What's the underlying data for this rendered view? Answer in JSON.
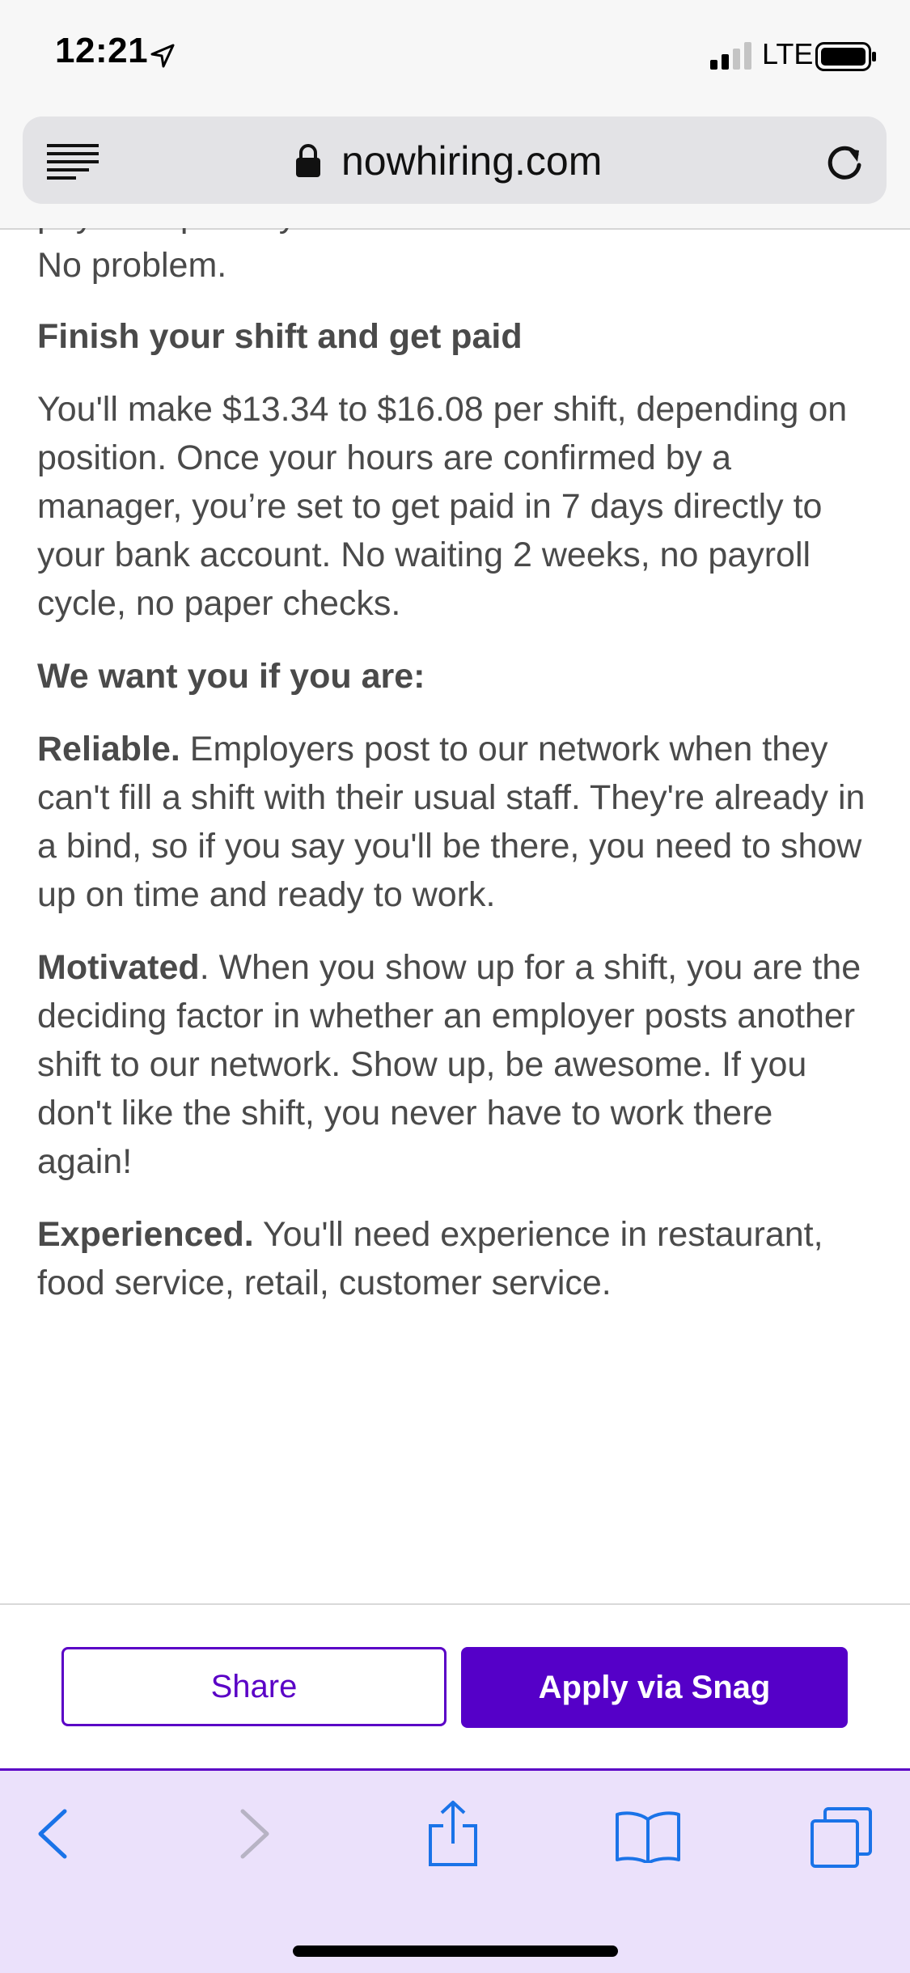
{
  "status_bar": {
    "time": "12:21",
    "network": "LTE",
    "icons": [
      "location-arrow-icon",
      "cellular-signal-icon",
      "battery-icon"
    ]
  },
  "address_bar": {
    "url": "nowhiring.com",
    "icons": [
      "reader-view-icon",
      "lock-icon",
      "reload-icon"
    ]
  },
  "article": {
    "clipped_line": "payment per day...",
    "no_problem": "No problem.",
    "finish_heading": "Finish your shift and get paid",
    "pay_paragraph": "You'll make $13.34 to $16.08 per shift, depending on position. Once your hours are confirmed by a manager, you’re set to get paid in 7 days directly to your bank account. No waiting 2 weeks, no payroll cycle, no paper checks.",
    "want_heading": "We want you if you are:",
    "reliable": {
      "lead": "Reliable.",
      "text": " Employers post to our network when they can't fill a shift with their usual staff. They're already in a bind, so if you say you'll be there, you need to show up on time and ready to work."
    },
    "motivated": {
      "lead": "Motivated",
      "text": ". When you show up for a shift, you are the deciding factor in whether an employer posts another shift to our network. Show up, be awesome. If you don't like the shift, you never have to work there again!"
    },
    "experienced": {
      "lead": "Experienced.",
      "text": " You'll need experience in restaurant, food service, retail, customer service."
    }
  },
  "actions": {
    "share_label": "Share",
    "apply_label": "Apply via Snag",
    "brand_color": "#5500c8"
  },
  "toolbar": {
    "icons": [
      "back-icon",
      "forward-icon",
      "share-icon",
      "bookmarks-icon",
      "tabs-icon"
    ],
    "accent_color": "#1a73e8"
  }
}
